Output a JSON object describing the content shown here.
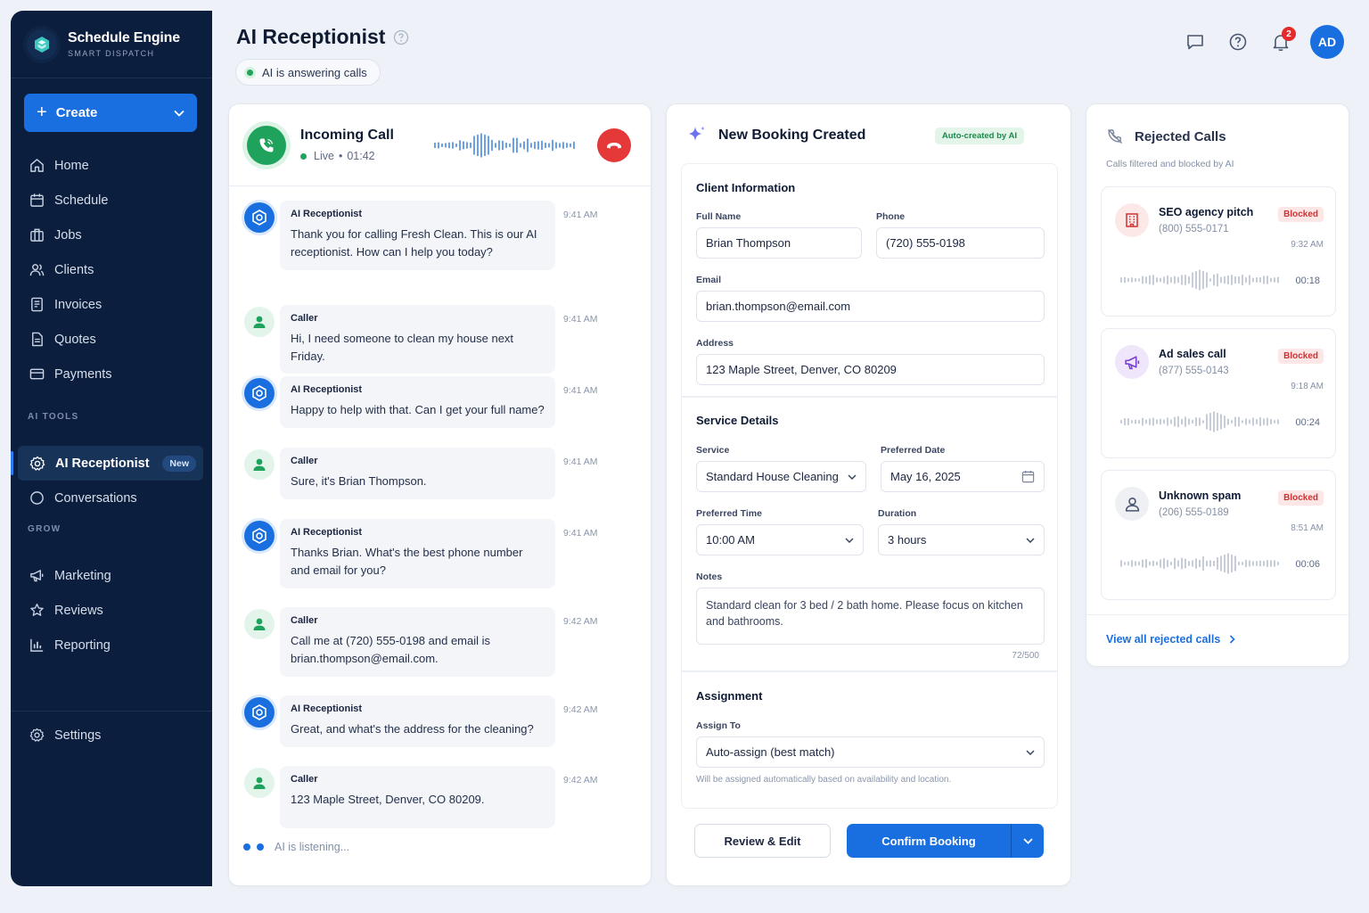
{
  "sidebar": {
    "brand_title": "Schedule Engine",
    "brand_sub": "SMART DISPATCH",
    "create_label": "Create",
    "items": [
      {
        "label": "Home",
        "icon": "home-icon"
      },
      {
        "label": "Schedule",
        "icon": "calendar-icon"
      },
      {
        "label": "Jobs",
        "icon": "briefcase-icon"
      },
      {
        "label": "Clients",
        "icon": "users-icon"
      },
      {
        "label": "Invoices",
        "icon": "invoice-icon"
      },
      {
        "label": "Quotes",
        "icon": "quote-icon"
      },
      {
        "label": "Payments",
        "icon": "credit-card-icon"
      }
    ],
    "ai_section": "AI TOOLS",
    "ai_items": [
      {
        "label": "AI Receptionist",
        "badge": "New",
        "active": true
      },
      {
        "label": "Conversations"
      }
    ],
    "grow_section": "GROW",
    "grow_items": [
      {
        "label": "Marketing"
      },
      {
        "label": "Reviews"
      },
      {
        "label": "Reporting"
      }
    ],
    "settings_label": "Settings"
  },
  "header": {
    "title": "AI Receptionist",
    "status": "AI is answering calls",
    "notification_count": "2",
    "avatar_initials": "AD"
  },
  "call": {
    "title": "Incoming Call",
    "live_label": "Live",
    "duration": "01:42",
    "messages": [
      {
        "role": "ai",
        "who": "AI Receptionist",
        "time": "9:41 AM",
        "text": "Thank you for calling Fresh Clean. This is our AI receptionist. How can I help you today?"
      },
      {
        "role": "caller",
        "who": "Caller",
        "time": "9:41 AM",
        "text": "Hi, I need someone to clean my house next Friday."
      },
      {
        "role": "ai",
        "who": "AI Receptionist",
        "time": "9:41 AM",
        "text": "Happy to help with that. Can I get your full name?"
      },
      {
        "role": "caller",
        "who": "Caller",
        "time": "9:41 AM",
        "text": "Sure, it's Brian Thompson."
      },
      {
        "role": "ai",
        "who": "AI Receptionist",
        "time": "9:41 AM",
        "text": "Thanks Brian. What's the best phone number and email for you?"
      },
      {
        "role": "caller",
        "who": "Caller",
        "time": "9:42 AM",
        "text": "Call me at (720) 555-0198 and email is brian.thompson@email.com."
      },
      {
        "role": "ai",
        "who": "AI Receptionist",
        "time": "9:42 AM",
        "text": "Great, and what's the address for the cleaning?"
      },
      {
        "role": "caller",
        "who": "Caller",
        "time": "9:42 AM",
        "text": "123 Maple Street, Denver, CO 80209."
      }
    ],
    "listening": "AI is listening..."
  },
  "booking": {
    "title": "New Booking Created",
    "auto_badge": "Auto-created by AI",
    "client_title": "Client Information",
    "full_name_label": "Full Name",
    "full_name": "Brian Thompson",
    "phone_label": "Phone",
    "phone": "(720) 555-0198",
    "email_label": "Email",
    "email": "brian.thompson@email.com",
    "address_label": "Address",
    "address": "123 Maple Street, Denver, CO 80209",
    "service_title": "Service Details",
    "service_label": "Service",
    "service": "Standard House Cleaning",
    "date_label": "Preferred Date",
    "date": "May 16, 2025",
    "time_label": "Preferred Time",
    "time": "10:00 AM",
    "duration_label": "Duration",
    "duration": "3 hours",
    "notes_label": "Notes",
    "notes": "Standard clean for 3 bed / 2 bath home. Please focus on kitchen and bathrooms.",
    "notes_count": "72/500",
    "assign_title": "Assignment",
    "assign_label": "Assign To",
    "assign": "Auto-assign (best match)",
    "assign_hint": "Will be assigned automatically based on availability and location.",
    "review_btn": "Review & Edit",
    "confirm_btn": "Confirm Booking"
  },
  "rejected": {
    "title": "Rejected Calls",
    "subtitle": "Calls filtered and blocked by AI",
    "items": [
      {
        "name": "SEO agency pitch",
        "phone": "(800) 555-0171",
        "badge": "Blocked",
        "time": "9:32 AM",
        "duration": "00:18",
        "icon": "building-icon"
      },
      {
        "name": "Ad sales call",
        "phone": "(877) 555-0143",
        "badge": "Blocked",
        "time": "9:18 AM",
        "duration": "00:24",
        "icon": "megaphone-icon"
      },
      {
        "name": "Unknown spam",
        "phone": "(206) 555-0189",
        "badge": "Blocked",
        "time": "8:51 AM",
        "duration": "00:06",
        "icon": "user-icon"
      }
    ],
    "view_all": "View all rejected calls"
  }
}
